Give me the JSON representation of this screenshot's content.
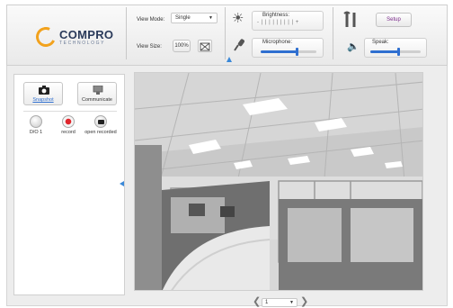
{
  "brand": {
    "name": "COMPRO",
    "tagline": "TECHNOLOGY",
    "ring_color": "#f2a21d"
  },
  "toolbar": {
    "view_mode_label": "View Mode:",
    "view_mode_value": "Single",
    "view_size_label": "View Size:",
    "view_size_value": "100%",
    "brightness_label": "Brightness:",
    "brightness_ticks": "- | | | | | | | | | +",
    "microphone_label": "Microphone:",
    "microphone_level": 0.65,
    "speaker_label": "Speak:",
    "speaker_level": 0.55,
    "setup_label": "Setup"
  },
  "left_panel": {
    "snapshot_label": "Snapshot",
    "communicate_label": "Communicate",
    "controls": [
      {
        "label": "D/O 1",
        "icon": "do-icon"
      },
      {
        "label": "record",
        "icon": "record-icon"
      },
      {
        "label": "open recorded",
        "icon": "folder-icon"
      }
    ]
  },
  "pager": {
    "current": "1"
  },
  "colors": {
    "accent": "#3a88d8",
    "slider": "#2f6fd0",
    "record": "#e0262d"
  }
}
